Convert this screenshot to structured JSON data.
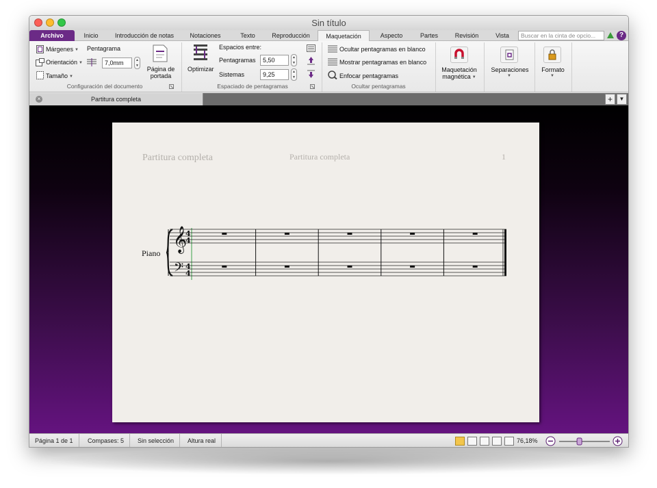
{
  "window": {
    "title": "Sin título"
  },
  "tabs": [
    {
      "label": "Archivo"
    },
    {
      "label": "Inicio"
    },
    {
      "label": "Introducción de notas"
    },
    {
      "label": "Notaciones"
    },
    {
      "label": "Texto"
    },
    {
      "label": "Reproducción"
    },
    {
      "label": "Maquetación"
    },
    {
      "label": "Aspecto"
    },
    {
      "label": "Partes"
    },
    {
      "label": "Revisión"
    },
    {
      "label": "Vista"
    }
  ],
  "search": {
    "placeholder": "Buscar en la cinta de opcio..."
  },
  "ribbon": {
    "doc_setup": {
      "margins": "Márgenes",
      "orientation": "Orientación",
      "size": "Tamaño",
      "staff": "Pentagrama",
      "staff_size_value": "7,0mm",
      "title_page_line1": "Página de",
      "title_page_line2": "portada",
      "group_label": "Configuración del documento"
    },
    "staff_spacing": {
      "optimize": "Optimizar",
      "spaces_between": "Espacios entre:",
      "staves_label": "Pentagramas",
      "staves_value": "5,50",
      "systems_label": "Sistemas",
      "systems_value": "9,25",
      "group_label": "Espaciado de pentagramas"
    },
    "hide_staves": {
      "hide_empty": "Ocultar pentagramas en blanco",
      "show_empty": "Mostrar pentagramas en blanco",
      "focus": "Enfocar pentagramas",
      "group_label": "Ocultar pentagramas"
    },
    "magnetic": {
      "line1": "Maquetación",
      "line2": "magnética"
    },
    "breaks": {
      "label": "Separaciones"
    },
    "format": {
      "label": "Formato"
    }
  },
  "doc_tab": {
    "label": "Partitura completa"
  },
  "score": {
    "header_left": "Partitura completa",
    "header_center": "Partitura completa",
    "page_number": "1",
    "instrument": "Piano",
    "time_signature_top": "4",
    "time_signature_bottom": "4",
    "measures": 5
  },
  "status": {
    "page": "Página 1 de 1",
    "bars": "Compases: 5",
    "selection": "Sin selección",
    "pitch": "Altura real",
    "zoom": "76,18%",
    "zoom_level": 0.4
  },
  "colors": {
    "accent": "#6b2a86",
    "canvas_bottom": "#64137f",
    "paper": "#f1eeea"
  }
}
